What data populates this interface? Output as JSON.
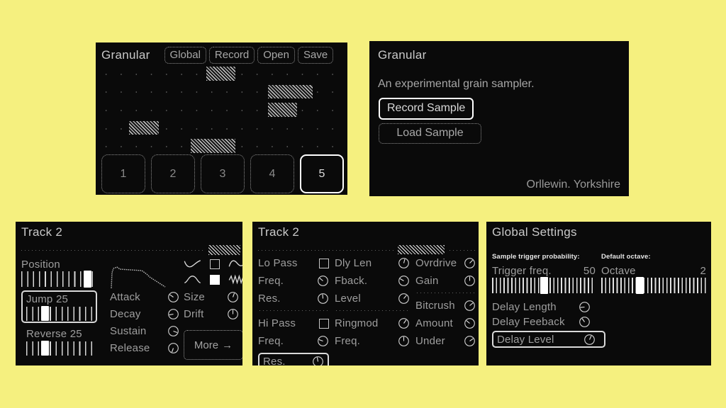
{
  "theme": {
    "page_bg": "#f5f07f",
    "panel_bg": "#0a0a0a",
    "text": "#9e9e9e",
    "highlight": "#ffffff"
  },
  "sequencer": {
    "title": "Granular",
    "buttons": [
      "Global",
      "Record",
      "Open",
      "Save"
    ],
    "grid": {
      "rows": 5,
      "cols": 16,
      "blocks": [
        {
          "row": 0,
          "col": 7,
          "span": 2
        },
        {
          "row": 1,
          "col": 11,
          "span": 3
        },
        {
          "row": 2,
          "col": 11,
          "span": 2
        },
        {
          "row": 3,
          "col": 2,
          "span": 2
        },
        {
          "row": 4,
          "col": 6,
          "span": 3
        }
      ]
    },
    "pads": [
      "1",
      "2",
      "3",
      "4",
      "5"
    ],
    "selected_pad": "5"
  },
  "about": {
    "title": "Granular",
    "description": "An experimental grain sampler.",
    "record_button": "Record Sample",
    "load_button": "Load Sample",
    "selected_button": "Record Sample",
    "credit": "Orllewin. Yorkshire"
  },
  "track": {
    "title": "Track 2",
    "position": {
      "label": "Position",
      "value": 92
    },
    "jump": {
      "label": "Jump",
      "value": "25",
      "percent": 25,
      "selected": true
    },
    "reverse": {
      "label": "Reverse",
      "value": "25",
      "percent": 25,
      "selected": false
    },
    "envelope": {
      "label": "envelope-curve"
    },
    "waveforms": [
      {
        "name": "curve-rise-icon",
        "box": "empty"
      },
      {
        "name": "s-curve-icon",
        "box": "grid"
      },
      {
        "name": "arch-curve-icon",
        "box": "filled"
      },
      {
        "name": "zigzag-icon",
        "box": "empty"
      }
    ],
    "adsr": [
      {
        "label": "Attack",
        "knob_angle": 305
      },
      {
        "label": "Decay",
        "knob_angle": 260
      },
      {
        "label": "Sustain",
        "knob_angle": 110
      },
      {
        "label": "Release",
        "knob_angle": 200
      }
    ],
    "grain": [
      {
        "label": "Size",
        "knob_angle": 20
      },
      {
        "label": "Drift",
        "knob_angle": 0
      }
    ],
    "more_button": "More",
    "more_arrow": "→"
  },
  "fx": {
    "title": "Track 2",
    "filter": [
      {
        "label": "Lo Pass",
        "control": "checkbox",
        "checked": false
      },
      {
        "label": "Freq.",
        "control": "knob",
        "knob_angle": 310
      },
      {
        "label": "Res.",
        "control": "knob",
        "knob_angle": 355
      },
      {
        "divider": true
      },
      {
        "label": "Hi Pass",
        "control": "checkbox",
        "checked": false
      },
      {
        "label": "Freq.",
        "control": "knob",
        "knob_angle": 290
      },
      {
        "label": "Res.",
        "control": "knob",
        "knob_angle": 350,
        "selected": true
      }
    ],
    "delay": [
      {
        "label": "Dly Len",
        "control": "knob",
        "knob_angle": 15
      },
      {
        "label": "Fback.",
        "control": "knob",
        "knob_angle": 300
      },
      {
        "label": "Level",
        "control": "knob",
        "knob_angle": 40
      },
      {
        "divider": true
      },
      {
        "label": "Ringmod",
        "control": "knob",
        "knob_angle": 35
      },
      {
        "label": "Freq.",
        "control": "knob",
        "knob_angle": 0
      }
    ],
    "drive": [
      {
        "label": "Ovrdrive",
        "control": "knob",
        "knob_angle": 45
      },
      {
        "label": "Gain",
        "control": "knob",
        "knob_angle": 0
      },
      {
        "divider": true
      },
      {
        "label": "Bitcrush",
        "control": "knob",
        "knob_angle": 50
      },
      {
        "label": "Amount",
        "control": "knob",
        "knob_angle": 310
      },
      {
        "label": "Under",
        "control": "knob",
        "knob_angle": 55
      }
    ]
  },
  "global": {
    "title": "Global Settings",
    "trigger": {
      "caption": "Sample trigger probability:",
      "label": "Trigger freq.",
      "value": "50",
      "percent": 50
    },
    "octave": {
      "caption": "Default octave:",
      "label": "Octave",
      "value": "2",
      "percent": 36
    },
    "delay_params": [
      {
        "label": "Delay Length",
        "knob_angle": 265,
        "selected": false
      },
      {
        "label": "Delay Feeback",
        "knob_angle": 325,
        "selected": false
      },
      {
        "label": "Delay Level",
        "knob_angle": 25,
        "selected": true
      }
    ]
  }
}
